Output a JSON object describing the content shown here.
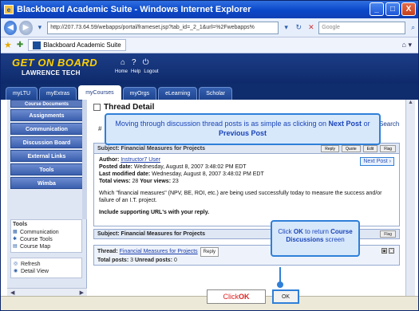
{
  "window": {
    "title": "Blackboard Academic Suite - Windows Internet Explorer",
    "minimize": "_",
    "maximize": "□",
    "close": "X"
  },
  "address": {
    "url": "http://207.73.64.59/webapps/portal/frameset.jsp?tab_id=_2_1&url=%2Fwebapps%",
    "search_placeholder": "Google"
  },
  "favorites": {
    "tab_label": "Blackboard Academic Suite"
  },
  "header": {
    "logo_line1": "GET ON BOARD",
    "logo_line2": "LAWRENCE TECH",
    "links": [
      "Home",
      "Help",
      "Logout"
    ]
  },
  "tabs": [
    "myLTU",
    "myExtras",
    "myCourses",
    "myOrgs",
    "eLearning",
    "Scholar"
  ],
  "active_tab": "myCourses",
  "sidebar": {
    "buttons": [
      "Course Documents",
      "Assignments",
      "Communication",
      "Discussion Board",
      "External Links",
      "Tools",
      "Wimba"
    ],
    "tools_title": "Tools",
    "tools": [
      "Communication",
      "Course Tools",
      "Course Map"
    ],
    "tools2": [
      "Refresh",
      "Detail View"
    ]
  },
  "main": {
    "thread_title": "Thread Detail",
    "search_link": "Search",
    "callout_top": {
      "prefix": "Moving through discussion thread posts is as simple as clicking on ",
      "bold1": "Next Post",
      "mid": " or ",
      "bold2": "Previous Post"
    },
    "post": {
      "subject_header": "Subject: Financial Measures for Projects",
      "author_label": "Author:",
      "author": "Instructor7 User",
      "posted_label": "Posted date:",
      "posted": "Wednesday, August 8, 2007 3:48:02 PM EDT",
      "modified_label": "Last modified date:",
      "modified": "Wednesday, August 8, 2007 3:48:02 PM EDT",
      "total_label": "Total views:",
      "total": "28",
      "your_label": "Your views:",
      "your": "23",
      "body": "Which \"financial measures\" (NPV, BE, ROI, etc.) are being used successfully today to measure the success and/or failure of an I.T. project.",
      "body2": "Include supporting URL's with your reply.",
      "next_post": "Next Post ›",
      "buttons": [
        "Reply",
        "Quote",
        "Edit",
        "Flag"
      ]
    },
    "subject_row": "Subject: Financial Measures for Projects",
    "flag": "Flag",
    "thread": {
      "label": "Thread:",
      "link": "Financial Measures for Projects",
      "reply": "Reply",
      "totals_label": "Total posts:",
      "totals": "3",
      "unread_label": "Unread posts:",
      "unread": "0"
    },
    "callout_bottom": {
      "prefix": "Click ",
      "bold1": "OK",
      "mid": " to return ",
      "bold2": "Course Discussions",
      "suffix": " screen"
    },
    "click_ok": {
      "prefix": "Click ",
      "bold": "OK"
    },
    "ok_button": "OK"
  }
}
